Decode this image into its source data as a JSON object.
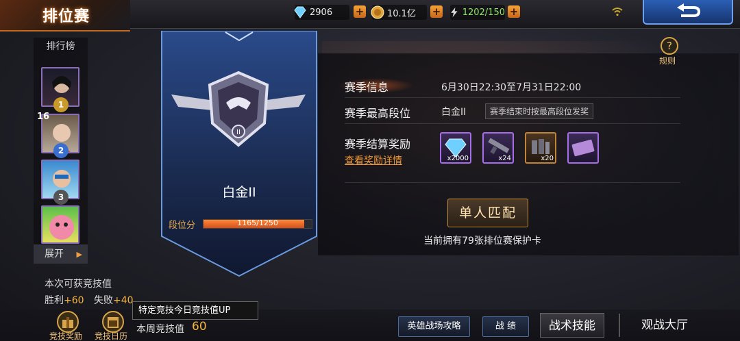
{
  "header": {
    "title": "排位赛",
    "diamonds": "2906",
    "gold": "10.1亿",
    "stamina": "1202/150"
  },
  "leaderboard": {
    "title": "排行榜",
    "ranks": [
      "1",
      "16",
      "2",
      "3"
    ],
    "expand_label": "展开"
  },
  "rank_card": {
    "rank_name": "白金II",
    "points_label": "段位分",
    "points_text": "1165/1250",
    "points_progress": 0.932,
    "emblem_numeral": "II"
  },
  "season": {
    "info_label": "赛季信息",
    "info_value": "6月30日22:30至7月31日22:00",
    "highest_label": "赛季最高段位",
    "highest_value": "白金II",
    "highest_note": "赛季结束时按最高段位发奖",
    "reward_label": "赛季结算奖励",
    "reward_link": "查看奖励详情",
    "rewards": [
      {
        "name": "diamond",
        "count": "x2000"
      },
      {
        "name": "rifle",
        "count": "x24"
      },
      {
        "name": "ammo",
        "count": "x20"
      },
      {
        "name": "ticket",
        "count": ""
      }
    ]
  },
  "match": {
    "button": "单人匹配",
    "protect_text": "当前拥有79张排位赛保护卡"
  },
  "help": {
    "label": "规则"
  },
  "gain": {
    "title": "本次可获竞技值",
    "win_label": "胜利",
    "win_value": "+60",
    "lose_label": "失败",
    "lose_value": "+40"
  },
  "tooltip": "特定竞技今日竞技值UP",
  "weekly": {
    "label": "本周竞技值",
    "value": "60"
  },
  "bottom": {
    "reward_label": "竞技奖励",
    "calendar_label": "竞技日历",
    "guide_btn": "英雄战场攻略",
    "record_btn": "战 绩",
    "tactics_btn": "战术技能",
    "watch_btn": "观战大厅"
  },
  "colors": {
    "accent": "#f5b544",
    "panel_blue": "#3a6fd0"
  }
}
